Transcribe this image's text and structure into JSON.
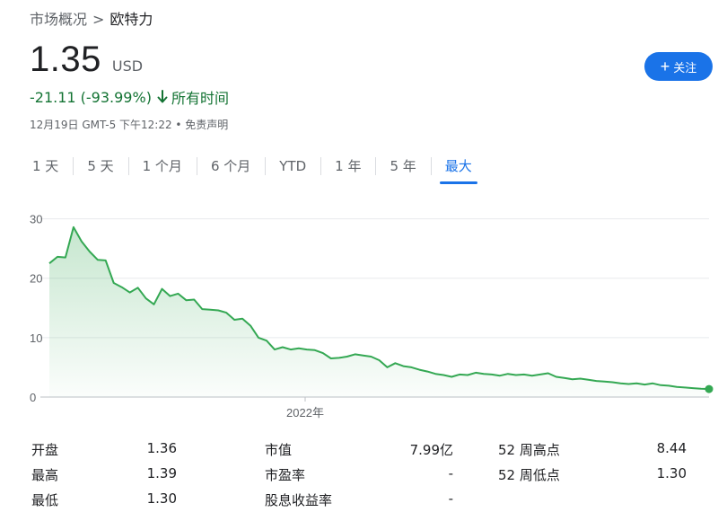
{
  "breadcrumb": {
    "parent": "市场概况",
    "separator": ">",
    "current": "欧特力"
  },
  "quote": {
    "price": "1.35",
    "currency": "USD",
    "change": "-21.11 (-93.99%)",
    "period": "所有时间",
    "timestamp": "12月19日 GMT-5 下午12:22 • 免责声明",
    "color_down": "#137333"
  },
  "follow_button": {
    "icon": "plus-icon",
    "label": "关注",
    "color": "#1a73e8"
  },
  "tabs": [
    {
      "label": "1 天",
      "active": false
    },
    {
      "label": "5 天",
      "active": false
    },
    {
      "label": "1 个月",
      "active": false
    },
    {
      "label": "6 个月",
      "active": false
    },
    {
      "label": "YTD",
      "active": false
    },
    {
      "label": "1 年",
      "active": false
    },
    {
      "label": "5 年",
      "active": false
    },
    {
      "label": "最大",
      "active": true
    }
  ],
  "chart_data": {
    "type": "area",
    "y_ticks": [
      "30",
      "20",
      "10",
      "0"
    ],
    "ylim": [
      0,
      31
    ],
    "x_tick_label": "2022年",
    "grid": true,
    "line_color": "#34a853",
    "values": [
      22.5,
      23.6,
      23.5,
      28.6,
      26.2,
      24.5,
      23.1,
      23.0,
      19.2,
      18.5,
      17.6,
      18.4,
      16.6,
      15.6,
      18.2,
      17.0,
      17.4,
      16.3,
      16.4,
      14.8,
      14.7,
      14.6,
      14.2,
      13.0,
      13.2,
      12.0,
      10.0,
      9.5,
      8.0,
      8.4,
      8.0,
      8.2,
      8.0,
      7.9,
      7.4,
      6.5,
      6.6,
      6.8,
      7.2,
      7.0,
      6.8,
      6.2,
      5.0,
      5.7,
      5.2,
      5.0,
      4.6,
      4.3,
      3.9,
      3.7,
      3.4,
      3.8,
      3.7,
      4.1,
      3.9,
      3.8,
      3.6,
      3.9,
      3.7,
      3.8,
      3.6,
      3.8,
      4.0,
      3.4,
      3.2,
      3.0,
      3.1,
      2.9,
      2.7,
      2.6,
      2.5,
      2.3,
      2.2,
      2.3,
      2.1,
      2.3,
      2.0,
      1.9,
      1.7,
      1.6,
      1.5,
      1.4,
      1.35
    ],
    "last_value": 1.35
  },
  "stats": {
    "rows": [
      [
        {
          "label": "开盘",
          "value": "1.36"
        },
        {
          "label": "市值",
          "value": "7.99亿"
        },
        {
          "label": "52 周高点",
          "value": "8.44"
        }
      ],
      [
        {
          "label": "最高",
          "value": "1.39"
        },
        {
          "label": "市盈率",
          "value": "-"
        },
        {
          "label": "52 周低点",
          "value": "1.30"
        }
      ],
      [
        {
          "label": "最低",
          "value": "1.30"
        },
        {
          "label": "股息收益率",
          "value": "-"
        },
        {
          "label": "",
          "value": ""
        }
      ]
    ]
  }
}
